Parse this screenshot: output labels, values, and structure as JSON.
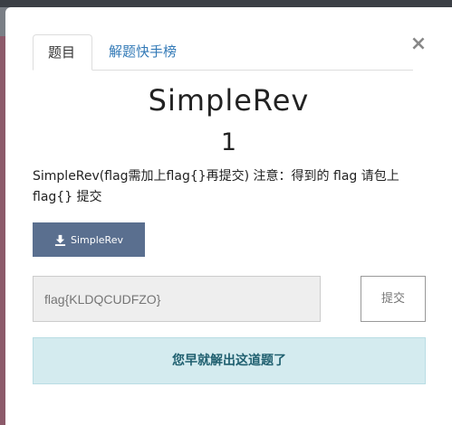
{
  "modal": {
    "tabs": [
      {
        "label": "题目",
        "active": true
      },
      {
        "label": "解题快手榜",
        "active": false
      }
    ],
    "close_glyph": "×",
    "title": "SimpleRev",
    "points": "1",
    "description": "SimpleRev(flag需加上flag{}再提交) 注意：得到的 flag 请包上 flag{} 提交",
    "download": {
      "label": "SimpleRev",
      "icon": "download-icon"
    },
    "flag_input": {
      "value": "",
      "placeholder": "flag{KLDQCUDFZO}"
    },
    "submit_label": "提交",
    "solved_message": "您早就解出这道题了"
  },
  "colors": {
    "download_button": "#5a6f8f",
    "solved_banner_bg": "#d4ebef",
    "solved_banner_text": "#1f5f6f",
    "tab_link": "#337ab7"
  }
}
